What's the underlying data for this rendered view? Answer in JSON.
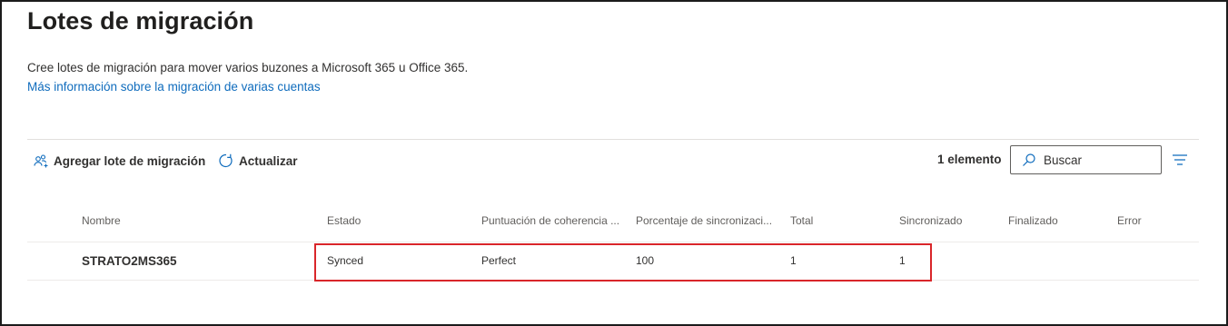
{
  "page": {
    "title": "Lotes de migración",
    "description": "Cree lotes de migración para mover varios buzones a Microsoft 365 u Office 365.",
    "learn_more_link": "Más información sobre la migración de varias cuentas"
  },
  "toolbar": {
    "add_label": "Agregar lote de migración",
    "refresh_label": "Actualizar",
    "item_count": "1 elemento",
    "search_placeholder": "Buscar",
    "icons": {
      "add": "people-add-icon",
      "refresh": "refresh-icon",
      "search": "search-icon",
      "filter": "filter-lines-icon"
    }
  },
  "table": {
    "columns": [
      "Nombre",
      "Estado",
      "Puntuación de coherencia ...",
      "Porcentaje de sincronizaci...",
      "Total",
      "Sincronizado",
      "Finalizado",
      "Error"
    ],
    "rows": [
      {
        "name": "STRATO2MS365",
        "status": "Synced",
        "consistency_score": "Perfect",
        "sync_percent": "100",
        "total": "1",
        "synced": "1",
        "finalized": "",
        "error": ""
      }
    ]
  },
  "colors": {
    "link": "#0f6cbd",
    "accent": "#0f6cbd",
    "highlight_border": "#d9262a",
    "text": "#323130"
  }
}
